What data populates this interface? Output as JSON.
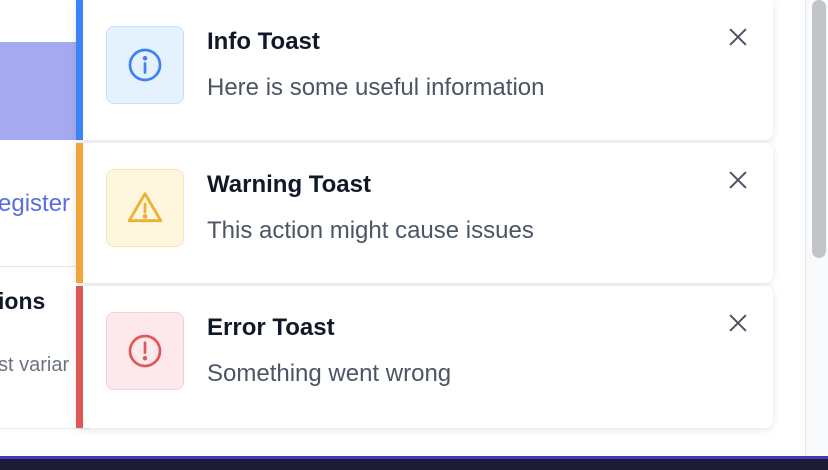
{
  "background": {
    "link_text": "egister",
    "heading_text": "ions",
    "subtext": "st variar"
  },
  "toasts": [
    {
      "variant": "info",
      "title": "Info Toast",
      "message": "Here is some useful information",
      "icon": "info-circle-icon",
      "accent_color": "#3b82f6"
    },
    {
      "variant": "warning",
      "title": "Warning Toast",
      "message": "This action might cause issues",
      "icon": "warning-triangle-icon",
      "accent_color": "#f0a43a"
    },
    {
      "variant": "error",
      "title": "Error Toast",
      "message": "Something went wrong",
      "icon": "error-circle-icon",
      "accent_color": "#e05757"
    }
  ]
}
